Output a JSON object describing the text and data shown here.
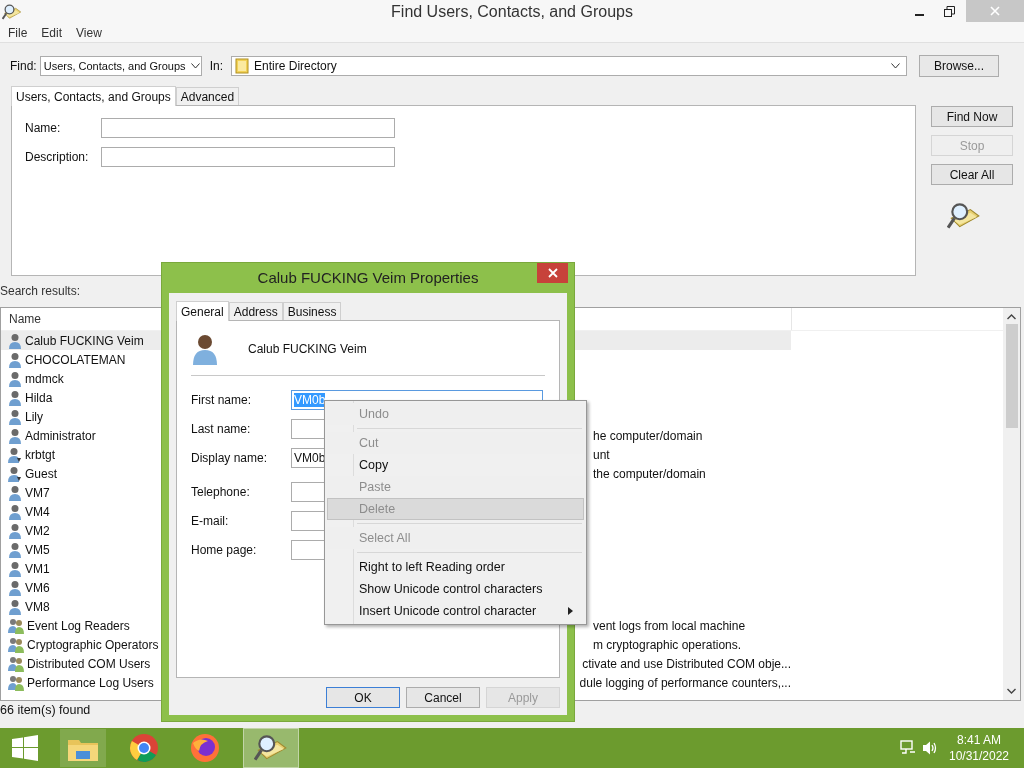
{
  "window": {
    "title": "Find Users, Contacts, and Groups"
  },
  "menu": [
    "File",
    "Edit",
    "View"
  ],
  "find_bar": {
    "find_label": "Find:",
    "find_value": "Users, Contacts, and Groups",
    "in_label": "In:",
    "in_value": "Entire Directory",
    "browse": "Browse..."
  },
  "tabs": [
    {
      "label": "Users, Contacts, and Groups",
      "selected": true
    },
    {
      "label": "Advanced",
      "selected": false
    }
  ],
  "fields": [
    {
      "label": "Name:"
    },
    {
      "label": "Description:"
    }
  ],
  "buttons": [
    {
      "label": "Find Now",
      "disabled": false
    },
    {
      "label": "Stop",
      "disabled": true
    },
    {
      "label": "Clear All",
      "disabled": false
    }
  ],
  "results_label": "Search results:",
  "results": {
    "columns": [
      "Name"
    ],
    "rows": [
      {
        "name": "Calub FUCKING Veim",
        "kind": "user",
        "selected": true
      },
      {
        "name": "CHOCOLATEMAN",
        "kind": "user",
        "selected": false
      },
      {
        "name": "mdmck",
        "kind": "user",
        "selected": false
      },
      {
        "name": "Hilda",
        "kind": "user",
        "selected": false
      },
      {
        "name": "Lily",
        "kind": "user",
        "selected": false
      },
      {
        "name": "Administrator",
        "kind": "user",
        "description": "he computer/domain",
        "selected": false
      },
      {
        "name": "krbtgt",
        "kind": "special",
        "description": "unt",
        "selected": false
      },
      {
        "name": "Guest",
        "kind": "special",
        "description": "the computer/domain",
        "selected": false
      },
      {
        "name": "VM7",
        "kind": "user",
        "selected": false
      },
      {
        "name": "VM4",
        "kind": "user",
        "selected": false
      },
      {
        "name": "VM2",
        "kind": "user",
        "selected": false
      },
      {
        "name": "VM5",
        "kind": "user",
        "selected": false
      },
      {
        "name": "VM1",
        "kind": "user",
        "selected": false
      },
      {
        "name": "VM6",
        "kind": "user",
        "selected": false
      },
      {
        "name": "VM8",
        "kind": "user",
        "selected": false
      },
      {
        "name": "Event Log Readers",
        "kind": "group",
        "description": "vent logs from local machine",
        "selected": false
      },
      {
        "name": "Cryptographic Operators",
        "kind": "group",
        "description": "m cryptographic operations.",
        "selected": false
      },
      {
        "name": "Distributed COM Users",
        "kind": "group",
        "description": "ctivate and use Distributed COM obje...",
        "selected": false
      },
      {
        "name": "Performance Log Users",
        "kind": "group",
        "description": "dule logging of performance counters,...",
        "selected": false
      }
    ]
  },
  "status": "66 item(s) found",
  "dialog": {
    "title": "Calub FUCKING Veim Properties",
    "tabs": [
      {
        "label": "General",
        "selected": true
      },
      {
        "label": "Address",
        "selected": false
      },
      {
        "label": "Business",
        "selected": false
      }
    ],
    "heading": "Calub FUCKING Veim",
    "groups": [
      [
        {
          "label": "First name:",
          "value": "VM0b",
          "text_selected": true
        },
        {
          "label": "Last name:"
        },
        {
          "label": "Display name:",
          "value": "VM0b",
          "text_selected": false
        }
      ],
      [
        {
          "label": "Telephone:"
        },
        {
          "label": "E-mail:"
        },
        {
          "label": "Home page:"
        }
      ]
    ],
    "buttons": [
      {
        "label": "OK",
        "disabled": false,
        "focused": true
      },
      {
        "label": "Cancel",
        "disabled": false,
        "focused": false
      },
      {
        "label": "Apply",
        "disabled": true,
        "focused": false
      }
    ]
  },
  "context_menu": [
    {
      "kind": "item",
      "label": "Undo",
      "disabled": true,
      "selected": false
    },
    {
      "kind": "separator"
    },
    {
      "kind": "item",
      "label": "Cut",
      "disabled": true,
      "selected": false
    },
    {
      "kind": "item",
      "label": "Copy",
      "disabled": false,
      "selected": false
    },
    {
      "kind": "item",
      "label": "Paste",
      "disabled": true,
      "selected": false
    },
    {
      "kind": "item",
      "label": "Delete",
      "disabled": true,
      "selected": true
    },
    {
      "kind": "separator"
    },
    {
      "kind": "item",
      "label": "Select All",
      "disabled": true,
      "selected": false
    },
    {
      "kind": "separator"
    },
    {
      "kind": "item",
      "label": "Right to left Reading order",
      "disabled": false,
      "selected": false
    },
    {
      "kind": "item",
      "label": "Show Unicode control characters",
      "disabled": false,
      "selected": false
    },
    {
      "kind": "item",
      "label": "Insert Unicode control character",
      "disabled": false,
      "selected": false,
      "submenu": true
    }
  ],
  "taskbar": {
    "apps": [
      {
        "kind": "explorer",
        "active": false
      },
      {
        "kind": "browser",
        "active": false
      },
      {
        "kind": "browser2",
        "active": false
      },
      {
        "kind": "finder",
        "active": true
      }
    ],
    "time": "8:41 AM",
    "date": "10/31/2022"
  }
}
